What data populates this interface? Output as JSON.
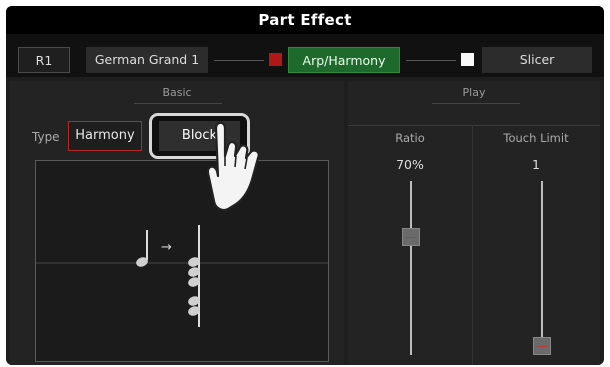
{
  "header": {
    "title": "Part Effect"
  },
  "topbar": {
    "part": "R1",
    "voice": "German Grand 1",
    "arp_harmony": "Arp/Harmony",
    "slicer": "Slicer",
    "colors": {
      "arp_active": "#1e6a2c",
      "arp_indicator": "#b01818",
      "slicer_indicator": "#fafafa"
    }
  },
  "basic": {
    "heading": "Basic",
    "type_label": "Type",
    "type_value": "Harmony",
    "mode_button": "Block"
  },
  "play": {
    "heading": "Play",
    "ratio": {
      "label": "Ratio",
      "value": "70%",
      "level": 0.7
    },
    "touch_limit": {
      "label": "Touch Limit",
      "value": "1",
      "level": 0.0
    }
  }
}
